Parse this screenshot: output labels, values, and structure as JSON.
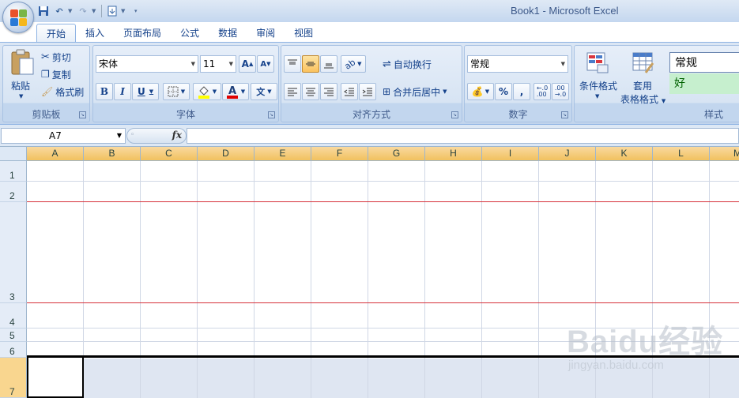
{
  "window": {
    "title": "Book1 - Microsoft Excel"
  },
  "tabs": [
    "开始",
    "插入",
    "页面布局",
    "公式",
    "数据",
    "审阅",
    "视图"
  ],
  "clipboard": {
    "paste_label": "粘贴",
    "cut_label": "剪切",
    "copy_label": "复制",
    "format_painter_label": "格式刷",
    "group_label": "剪贴板"
  },
  "font": {
    "font_name": "宋体",
    "font_size": "11",
    "bold": "B",
    "italic": "I",
    "underline": "U",
    "group_label": "字体"
  },
  "alignment": {
    "wrap_text_label": "自动换行",
    "merge_center_label": "合并后居中",
    "group_label": "对齐方式"
  },
  "number": {
    "format": "常规",
    "percent": "%",
    "comma": ",",
    "group_label": "数字"
  },
  "styles": {
    "conditional_format_label": "条件格式",
    "table_format_label_1": "套用",
    "table_format_label_2": "表格格式",
    "style_normal": "常规",
    "style_good": "好",
    "group_label": "样式"
  },
  "formula_bar": {
    "name_box": "A7",
    "fx": "fx",
    "formula": ""
  },
  "columns": [
    "A",
    "B",
    "C",
    "D",
    "E",
    "F",
    "G",
    "H",
    "I",
    "J",
    "K",
    "L",
    "M"
  ],
  "rows": [
    "1",
    "2",
    "3",
    "4",
    "5",
    "6",
    "7"
  ],
  "watermark": {
    "main": "Baidu经验",
    "sub": "jingyan.baidu.com"
  },
  "colors": {
    "accent": "#15428b",
    "selected_header": "#f1c15f",
    "red_border": "#d6313b"
  }
}
